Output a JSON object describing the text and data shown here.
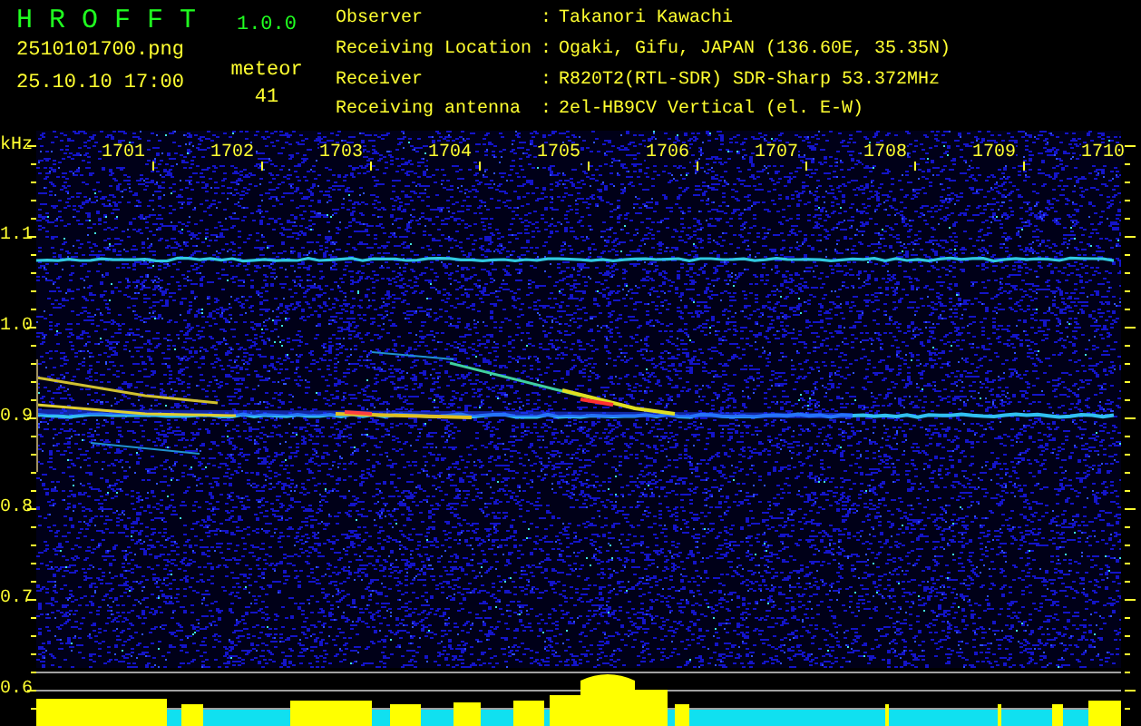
{
  "app": {
    "name": "H R O F F T",
    "version": "1.0.0"
  },
  "file": {
    "name": "2510101700.png",
    "datetime": "25.10.10 17:00"
  },
  "counter": {
    "label": "meteor",
    "value": "41"
  },
  "info": [
    {
      "label": "Observer",
      "separator": ":",
      "value": "Takanori Kawachi"
    },
    {
      "label": "Receiving Location",
      "separator": ":",
      "value": "Ogaki, Gifu, JAPAN (136.60E, 35.35N)"
    },
    {
      "label": "Receiver",
      "separator": ":",
      "value": "R820T2(RTL-SDR) SDR-Sharp 53.372MHz"
    },
    {
      "label": "Receiving antenna",
      "separator": ":",
      "value": "2el-HB9CV Vertical (el. E-W)"
    }
  ],
  "spectrogram": {
    "unit": "kHz",
    "time_labels": [
      "1701",
      "1702",
      "1703",
      "1704",
      "1705",
      "1706",
      "1707",
      "1708",
      "1709",
      "1710"
    ],
    "freq_labels": [
      "1.1",
      "1.0",
      "0.9",
      "0.8",
      "0.7",
      "0.6"
    ]
  }
}
